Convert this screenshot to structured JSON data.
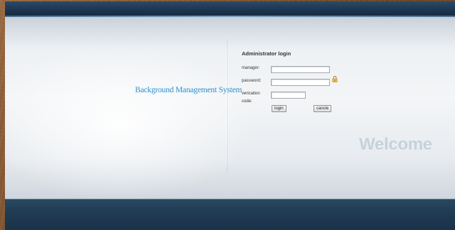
{
  "branding": {
    "system_title": "Background Management System",
    "welcome_text": "Welcome"
  },
  "login_form": {
    "title": "Administrator login",
    "manager_label": "manager:",
    "password_label": "password:",
    "verification_label_line1": "verication",
    "verification_label_line2": "code:",
    "manager_value": "",
    "password_value": "",
    "verification_value": "",
    "login_button": "login",
    "cancel_button": "cancle"
  },
  "icons": {
    "password_helper": "lock-icon"
  },
  "colors": {
    "header_bar": "#1d3550",
    "footer_bar": "#1f3a52",
    "system_title": "#2d8fd0",
    "welcome_watermark": "#c5d2dd"
  }
}
